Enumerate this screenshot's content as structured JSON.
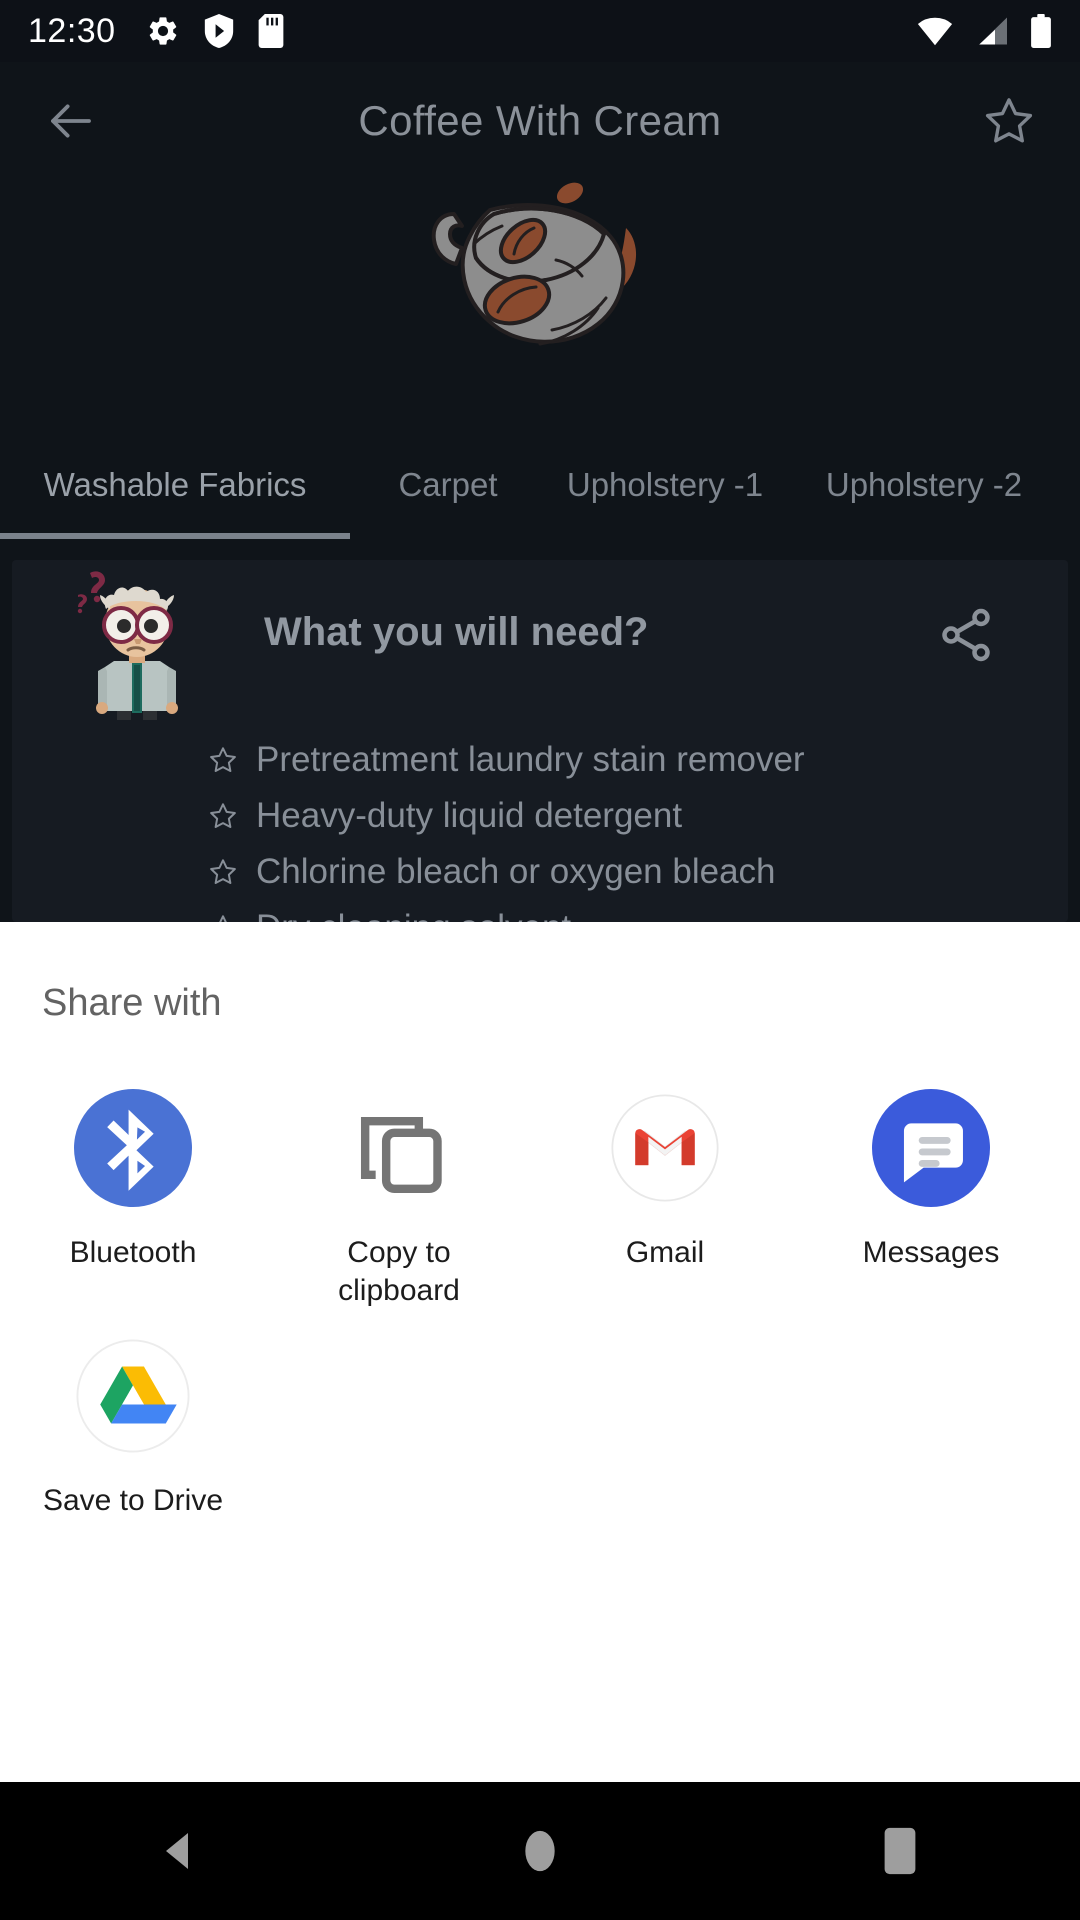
{
  "status_bar": {
    "clock": "12:30",
    "left_icons": [
      "settings-gear-icon",
      "play-protect-shield-icon",
      "sd-card-icon"
    ],
    "right_icons": [
      "wifi-icon",
      "cellular-signal-icon",
      "battery-icon"
    ]
  },
  "app_bar": {
    "back_icon": "back-arrow-icon",
    "title": "Coffee With Cream",
    "favorite_icon": "star-outline-icon"
  },
  "hero": {
    "logo_name": "coffee-cup-logo",
    "colors": {
      "cup": "#8d8d8d",
      "splash": "#8a4a2e",
      "bean": "#8a4a2e",
      "outline": "#231f20"
    }
  },
  "tabs": {
    "items": [
      {
        "label": "Washable Fabrics",
        "active": true
      },
      {
        "label": "Carpet",
        "active": false
      },
      {
        "label": "Upholstery -1",
        "active": false
      },
      {
        "label": "Upholstery -2",
        "active": false
      }
    ],
    "indicator_color": "#7a828b"
  },
  "card": {
    "avatar_name": "confused-scientist-avatar",
    "title": "What you will need?",
    "share_icon": "share-icon",
    "items": [
      "Pretreatment laundry stain remover",
      "Heavy-duty liquid detergent",
      "Chlorine bleach or oxygen bleach",
      "Dry cleaning solvent"
    ]
  },
  "share_sheet": {
    "title": "Share with",
    "targets": [
      {
        "label": "Bluetooth",
        "icon": "bluetooth-icon",
        "color": "#4a72d4"
      },
      {
        "label": "Copy to clipboard",
        "icon": "copy-to-clipboard-icon",
        "color": "#757575"
      },
      {
        "label": "Gmail",
        "icon": "gmail-icon",
        "color": "#ea4335"
      },
      {
        "label": "Messages",
        "icon": "messages-icon",
        "color": "#3b5bdb"
      },
      {
        "label": "Save to Drive",
        "icon": "google-drive-icon",
        "color": "#1da462"
      }
    ]
  },
  "nav_bar": {
    "back": "nav-back-icon",
    "home": "nav-home-icon",
    "recents": "nav-recents-icon",
    "icon_color": "#9e9e9e"
  }
}
